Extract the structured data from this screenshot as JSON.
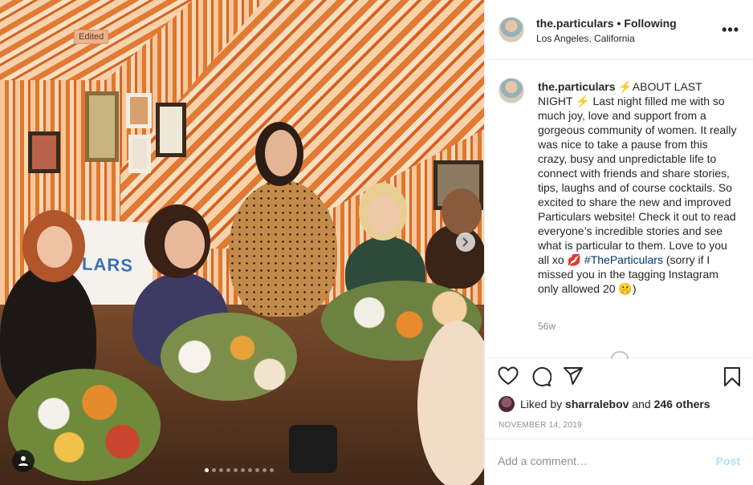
{
  "photo": {
    "edited_label": "Edited",
    "banner_text": "LARS",
    "carousel_dots": 10,
    "carousel_active_index": 0
  },
  "header": {
    "username": "the.particulars",
    "separator": "•",
    "follow_state": "Following",
    "location": "Los Angeles, California",
    "more_label": "•••"
  },
  "caption": {
    "username": "the.particulars",
    "text_before_tag": "⚡ABOUT LAST NIGHT ⚡ Last night filled me with so much joy, love and support from a gorgeous community of women. It really was nice to take a pause from this crazy, busy and unpredictable life to connect with friends and share stories, tips, laughs and of course cocktails. So excited to share the new and improved Particulars website! Check it out to read everyone’s incredible stories and see what is particular to them. Love to you all xo 💋 ",
    "hashtag": "#TheParticulars",
    "text_after_tag": " (sorry if I missed you in the tagging Instagram only allowed 20 🤫)",
    "age": "56w"
  },
  "likes": {
    "prefix": "Liked by",
    "user": "sharralebov",
    "conjunction": "and",
    "others": "246 others"
  },
  "post_date": "NOVEMBER 14, 2019",
  "comment": {
    "placeholder": "Add a comment…",
    "post_label": "Post"
  },
  "colors": {
    "link": "#00376b",
    "post_disabled": "#b2dffc",
    "muted": "#8e8e8e"
  }
}
